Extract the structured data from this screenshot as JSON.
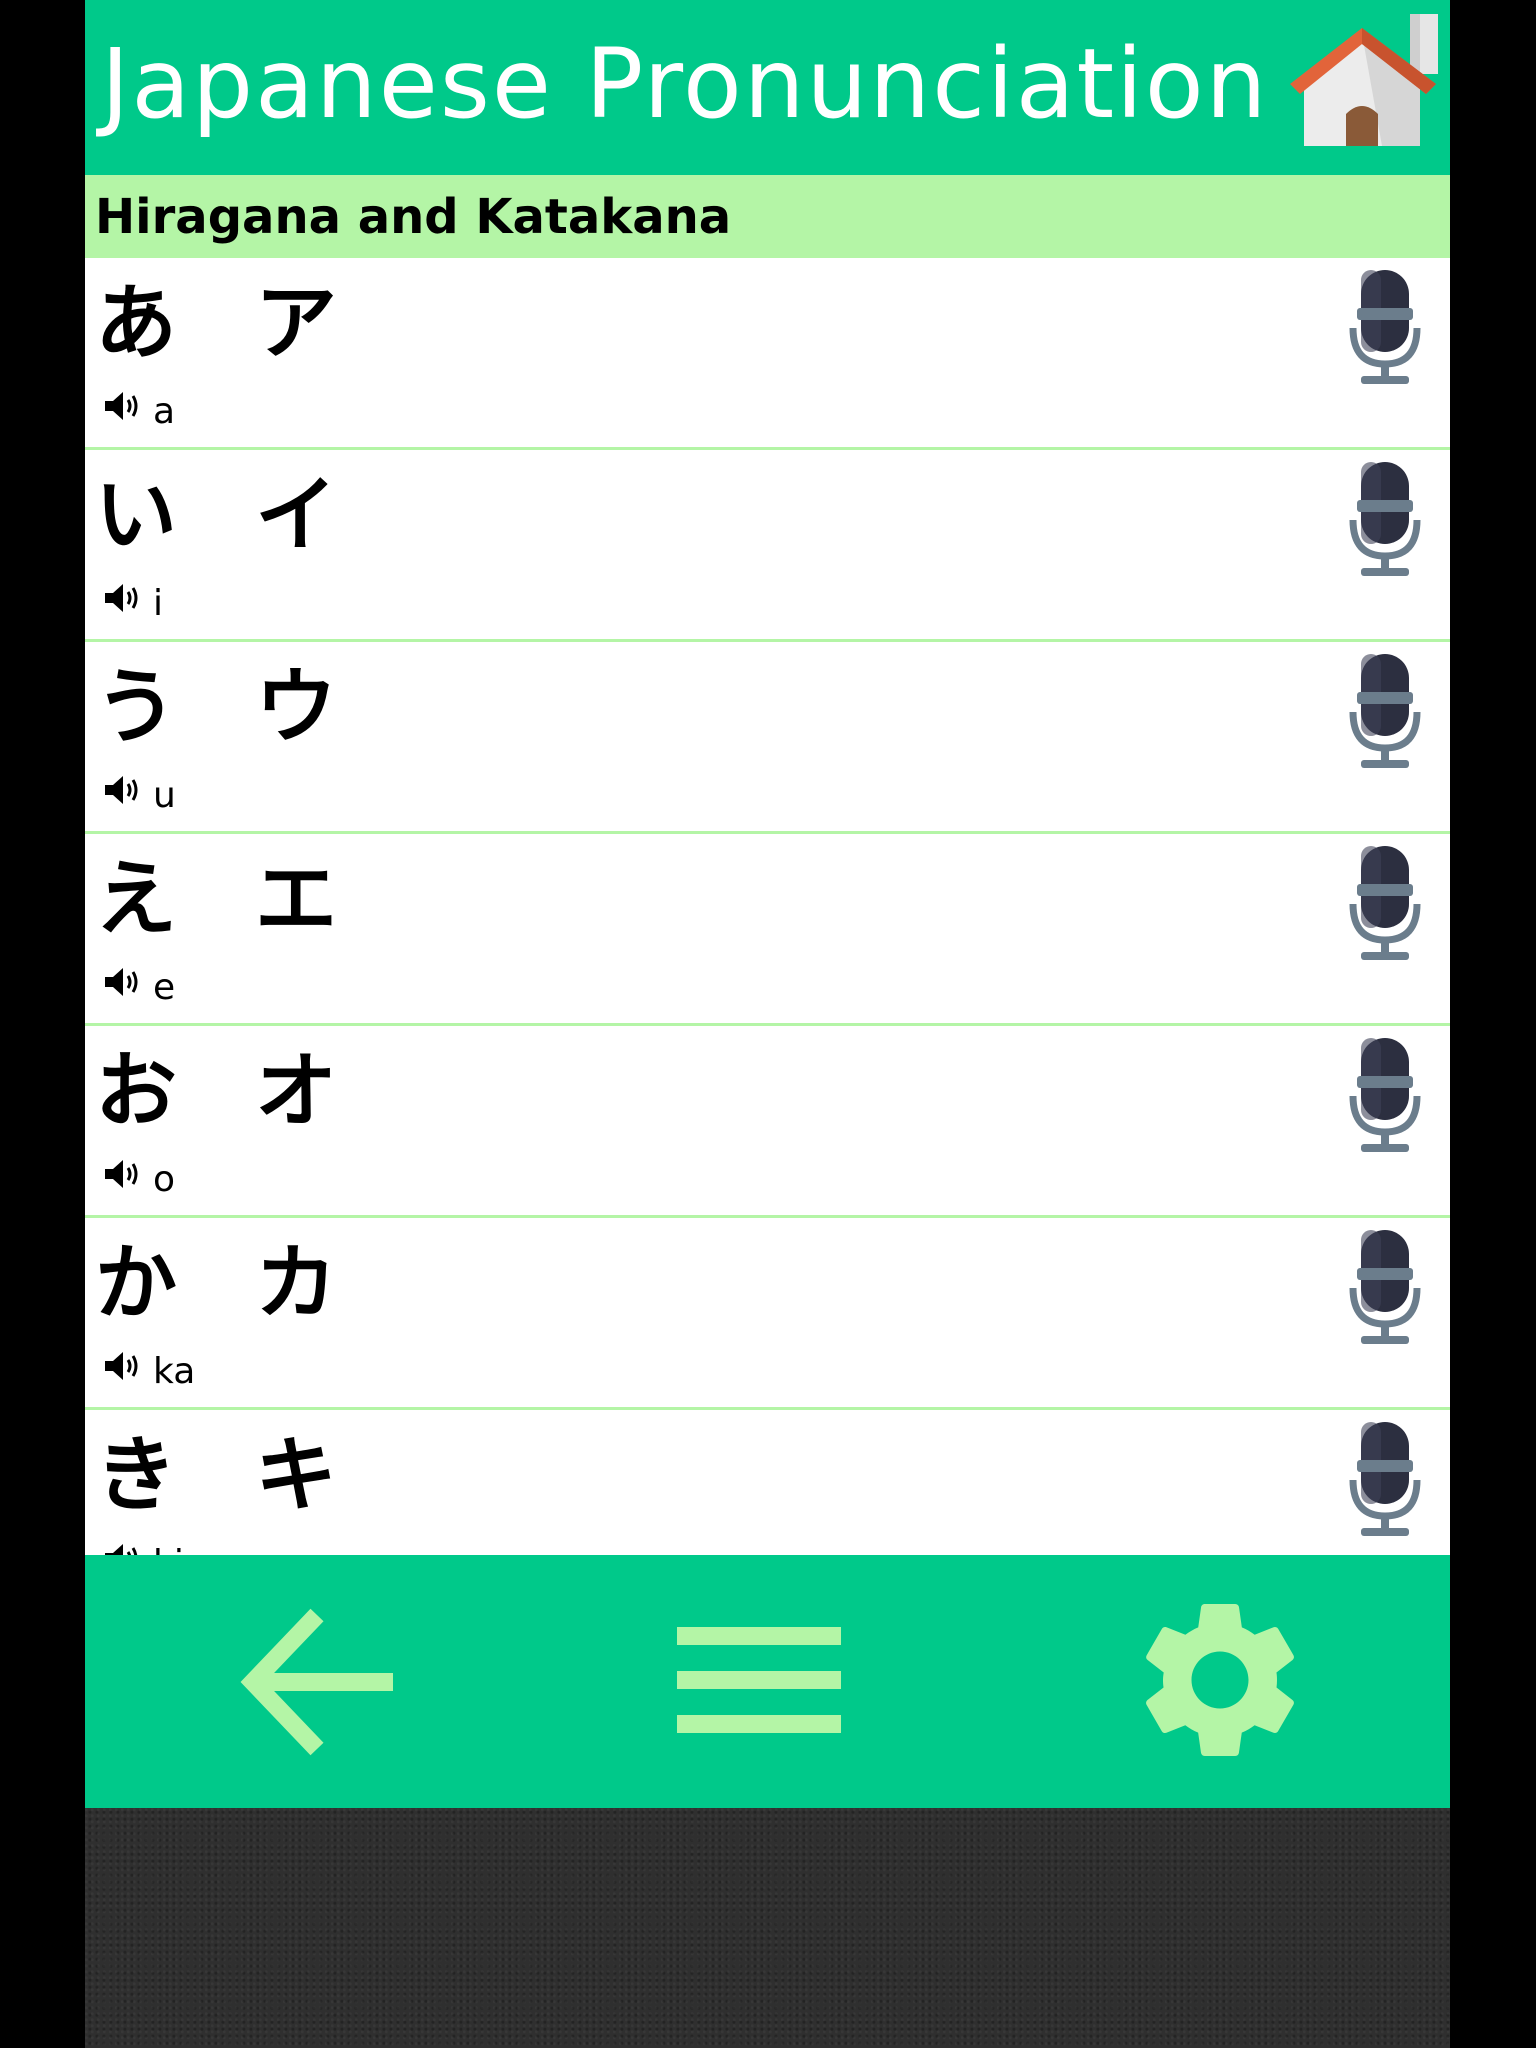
{
  "header": {
    "title": "Japanese Pronunciation",
    "home_icon": "home-icon"
  },
  "section": {
    "title": "Hiragana and Katakana"
  },
  "rows": [
    {
      "hiragana": "あ",
      "katakana": "ア",
      "romaji": "a"
    },
    {
      "hiragana": "い",
      "katakana": "イ",
      "romaji": "i"
    },
    {
      "hiragana": "う",
      "katakana": "ウ",
      "romaji": "u"
    },
    {
      "hiragana": "え",
      "katakana": "エ",
      "romaji": "e"
    },
    {
      "hiragana": "お",
      "katakana": "オ",
      "romaji": "o"
    },
    {
      "hiragana": "か",
      "katakana": "カ",
      "romaji": "ka"
    },
    {
      "hiragana": "き",
      "katakana": "キ",
      "romaji": "ki"
    }
  ],
  "icons": {
    "row_audio": "speaker-icon",
    "row_record": "microphone-icon"
  },
  "bottom_nav": {
    "back": "back-arrow-icon",
    "menu": "hamburger-menu-icon",
    "settings": "gear-icon"
  },
  "colors": {
    "primary": "#00c98a",
    "accent_light": "#b4f5a6",
    "text": "#000000",
    "title_text": "#ffffff"
  }
}
